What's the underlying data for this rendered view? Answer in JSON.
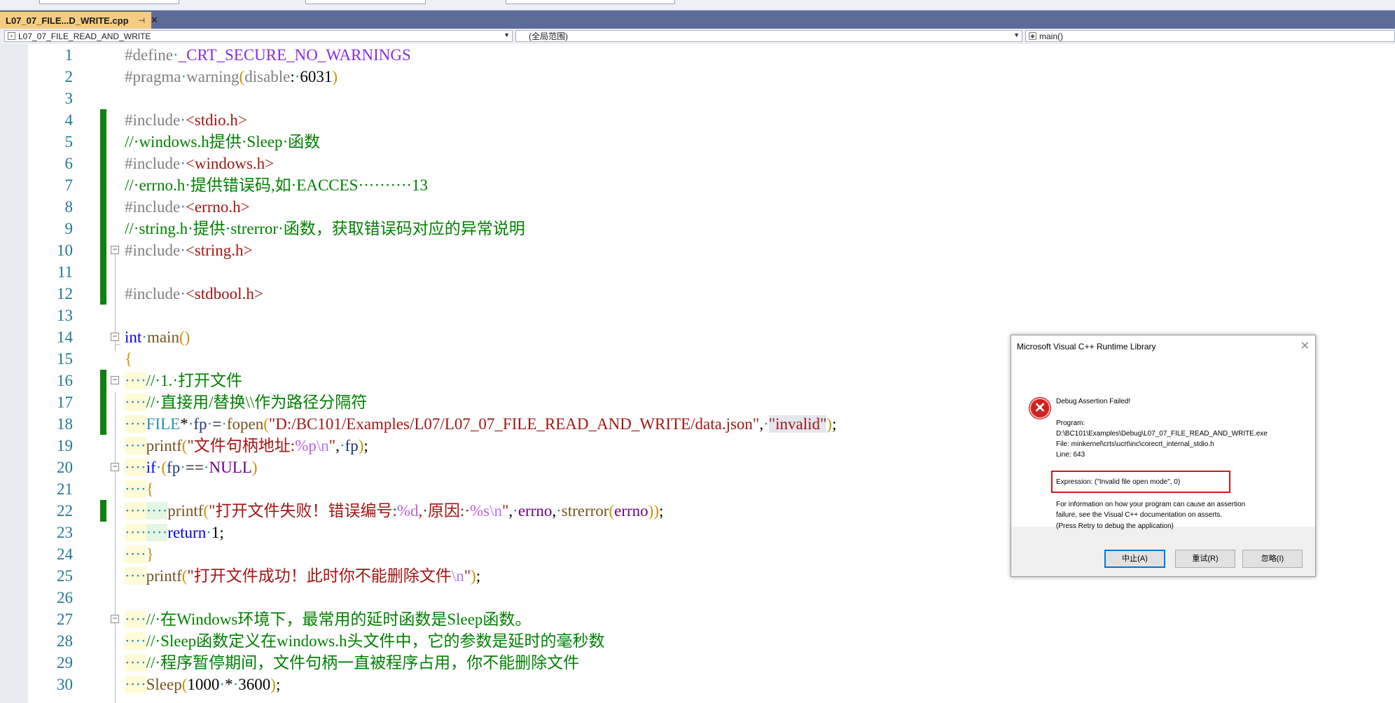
{
  "tab": {
    "title": "L07_07_FILE...D_WRITE.cpp",
    "pin_icon": "pin-icon",
    "close_icon": "close-icon"
  },
  "nav": {
    "project": "L07_07_FILE_READ_AND_WRITE",
    "scope": "(全局范围)",
    "function": "main()"
  },
  "editor": {
    "lines": [
      {
        "n": "1"
      },
      {
        "n": "2"
      },
      {
        "n": "3"
      },
      {
        "n": "4"
      },
      {
        "n": "5"
      },
      {
        "n": "6"
      },
      {
        "n": "7"
      },
      {
        "n": "8"
      },
      {
        "n": "9"
      },
      {
        "n": "10"
      },
      {
        "n": "11"
      },
      {
        "n": "12"
      },
      {
        "n": "13"
      },
      {
        "n": "14"
      },
      {
        "n": "15"
      },
      {
        "n": "16"
      },
      {
        "n": "17"
      },
      {
        "n": "18"
      },
      {
        "n": "19"
      },
      {
        "n": "20"
      },
      {
        "n": "21"
      },
      {
        "n": "22"
      },
      {
        "n": "23"
      },
      {
        "n": "24"
      },
      {
        "n": "25"
      },
      {
        "n": "26"
      },
      {
        "n": "27"
      },
      {
        "n": "28"
      },
      {
        "n": "29"
      },
      {
        "n": "30"
      }
    ],
    "code": {
      "l1a": "#define",
      "l1b": "_CRT_SECURE_NO_WARNINGS",
      "l2a": "#pragma",
      "l2b": "warning",
      "l2c": "disable",
      "l2d": "6031",
      "l4a": "#include",
      "l4b": "<stdio.h>",
      "l5": "//·windows.h提供·Sleep·函数",
      "l6a": "#include",
      "l6b": "<windows.h>",
      "l7": "//·errno.h·提供错误码,如·EACCES··········13",
      "l8a": "#include",
      "l8b": "<errno.h>",
      "l9": "//·string.h·提供·strerror·函数，获取错误码对应的异常说明",
      "l10a": "#include",
      "l10b": "<string.h>",
      "l12a": "#include",
      "l12b": "<stdbool.h>",
      "l14a": "int",
      "l14b": "main",
      "l16": "//·1.·打开文件",
      "l17": "//·直接用/替换\\\\作为路径分隔符",
      "l18a": "FILE",
      "l18b": "fp",
      "l18c": "fopen",
      "l18d": "\"D:/BC101/Examples/L07/L07_07_FILE_READ_AND_WRITE/data.json\"",
      "l18e": "\"invalid\"",
      "l19a": "printf",
      "l19b": "\"文件句柄地址:",
      "l19c": "%p",
      "l19d": "\\n",
      "l19e": "\"",
      "l19f": "fp",
      "l20a": "if",
      "l20b": "fp",
      "l20c": "NULL",
      "l22a": "printf",
      "l22b": "\"打开文件失败！错误编号:",
      "l22c": "%d",
      "l22d": ",·原因:·",
      "l22e": "%s",
      "l22f": "\\n",
      "l22g": "\"",
      "l22h": "errno",
      "l22i": "strerror",
      "l22j": "errno",
      "l23a": "return",
      "l23b": "1",
      "l25a": "printf",
      "l25b": "\"打开文件成功！此时你不能删除文件",
      "l25c": "\\n",
      "l25d": "\"",
      "l27": "//·在Windows环境下，最常用的延时函数是Sleep函数。",
      "l28": "//·Sleep函数定义在windows.h头文件中，它的参数是延时的毫秒数",
      "l29": "//·程序暂停期间，文件句柄一直被程序占用，你不能删除文件",
      "l30a": "Sleep",
      "l30b": "1000",
      "l30c": "3600"
    }
  },
  "dialog": {
    "title": "Microsoft Visual C++ Runtime Library",
    "heading": "Debug Assertion Failed!",
    "program_label": "Program:",
    "program_path": "D:\\BC101\\Examples\\Debug\\L07_07_FILE_READ_AND_WRITE.exe",
    "file_line": "File: minkernel\\crts\\ucrt\\inc\\corecrt_internal_stdio.h",
    "line_line": "Line: 643",
    "expression": "Expression: (\"Invalid file open mode\", 0)",
    "info1": "For information on how your program can cause an assertion",
    "info2": "failure, see the Visual C++ documentation on asserts.",
    "press": "(Press Retry to debug the application)",
    "buttons": {
      "abort": "中止(A)",
      "retry": "重试(R)",
      "ignore": "忽略(I)"
    },
    "icon": "error-icon"
  }
}
